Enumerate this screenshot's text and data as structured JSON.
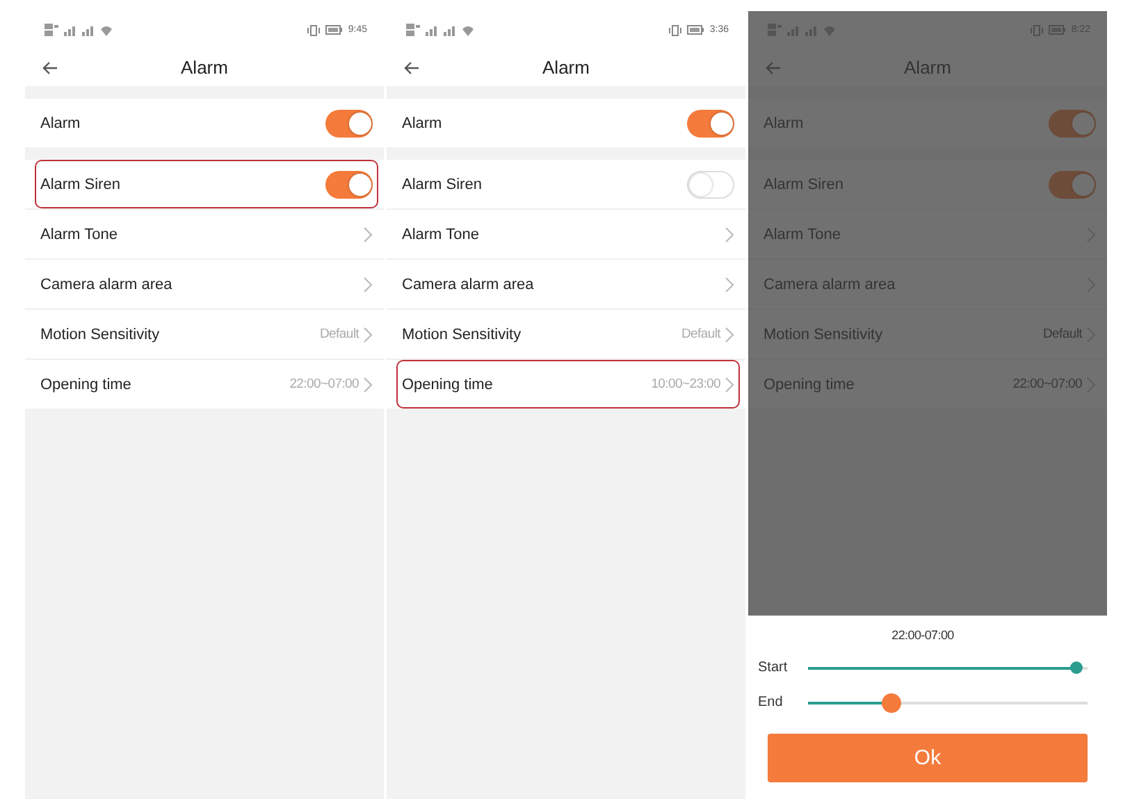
{
  "screens": [
    {
      "status_bar": {
        "time": "9:45"
      },
      "header": {
        "title": "Alarm"
      },
      "dimmed": false,
      "sections": [
        [
          {
            "kind": "toggle",
            "label": "Alarm",
            "on": true,
            "highlighted": false
          }
        ],
        [
          {
            "kind": "toggle",
            "label": "Alarm Siren",
            "on": true,
            "highlighted": true
          },
          {
            "kind": "link",
            "label": "Alarm Tone",
            "highlighted": false
          },
          {
            "kind": "link",
            "label": "Camera alarm area",
            "highlighted": false
          },
          {
            "kind": "link",
            "label": "Motion Sensitivity",
            "value": "Default",
            "highlighted": false
          },
          {
            "kind": "link",
            "label": "Opening time",
            "value": "22:00~07:00",
            "highlighted": false
          }
        ]
      ]
    },
    {
      "status_bar": {
        "time": "3:36"
      },
      "header": {
        "title": "Alarm"
      },
      "dimmed": false,
      "sections": [
        [
          {
            "kind": "toggle",
            "label": "Alarm",
            "on": true,
            "highlighted": false
          }
        ],
        [
          {
            "kind": "toggle",
            "label": "Alarm Siren",
            "on": false,
            "highlighted": false
          },
          {
            "kind": "link",
            "label": "Alarm Tone",
            "highlighted": false
          },
          {
            "kind": "link",
            "label": "Camera alarm area",
            "highlighted": false
          },
          {
            "kind": "link",
            "label": "Motion Sensitivity",
            "value": "Default",
            "highlighted": false
          },
          {
            "kind": "link",
            "label": "Opening time",
            "value": "10:00~23:00",
            "highlighted": true
          }
        ]
      ]
    },
    {
      "status_bar": {
        "time": "8:22"
      },
      "header": {
        "title": "Alarm"
      },
      "dimmed": true,
      "sections": [
        [
          {
            "kind": "toggle",
            "label": "Alarm",
            "on": true,
            "highlighted": false
          }
        ],
        [
          {
            "kind": "toggle",
            "label": "Alarm Siren",
            "on": true,
            "highlighted": false
          },
          {
            "kind": "link",
            "label": "Alarm Tone",
            "highlighted": false
          },
          {
            "kind": "link",
            "label": "Camera alarm area",
            "highlighted": false
          },
          {
            "kind": "link",
            "label": "Motion Sensitivity",
            "value": "Default",
            "highlighted": false
          },
          {
            "kind": "link",
            "label": "Opening time",
            "value": "22:00~07:00",
            "highlighted": false
          }
        ]
      ],
      "time_sheet": {
        "range": "22:00-07:00",
        "sliders": [
          {
            "label": "Start",
            "level": 0.96,
            "active": false
          },
          {
            "label": "End",
            "level": 0.3,
            "active": true
          }
        ],
        "button": "Ok"
      }
    }
  ]
}
